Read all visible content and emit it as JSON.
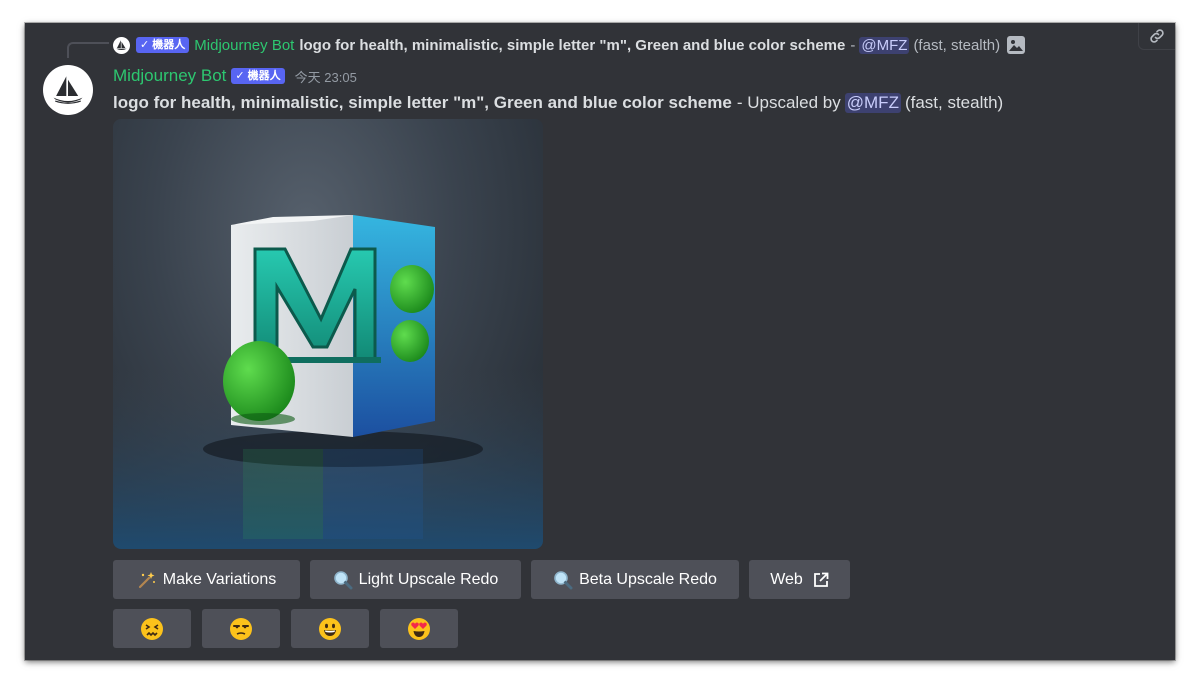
{
  "reply": {
    "bot_tag": "✓ 機器人",
    "author": "Midjourney Bot",
    "prompt": "logo for health, minimalistic, simple letter \"m\", Green and blue color scheme",
    "dash": "-",
    "mention": "@MFZ",
    "suffix": "(fast, stealth)"
  },
  "message": {
    "author": "Midjourney Bot",
    "bot_tag": "✓ 機器人",
    "timestamp": "今天 23:05",
    "prompt": "logo for health, minimalistic, simple letter \"m\", Green and blue color scheme",
    "upscaled_text": "- Upscaled by",
    "mention": "@MFZ",
    "suffix": "(fast, stealth)"
  },
  "image": {
    "letter": "M"
  },
  "buttons": [
    {
      "label": "Make Variations",
      "icon": "magic-wand-icon"
    },
    {
      "label": "Light Upscale Redo",
      "icon": "magnifier-icon"
    },
    {
      "label": "Beta Upscale Redo",
      "icon": "magnifier-icon"
    },
    {
      "label": "Web",
      "icon": "external-link-icon"
    }
  ],
  "reactions": [
    {
      "icon": "confounded-face-icon"
    },
    {
      "icon": "unamused-face-icon"
    },
    {
      "icon": "grinning-face-icon"
    },
    {
      "icon": "heart-eyes-face-icon"
    }
  ],
  "colors": {
    "background": "#313338",
    "author": "#2dc770",
    "button": "#4e5058",
    "bot_tag": "#5865f2"
  }
}
